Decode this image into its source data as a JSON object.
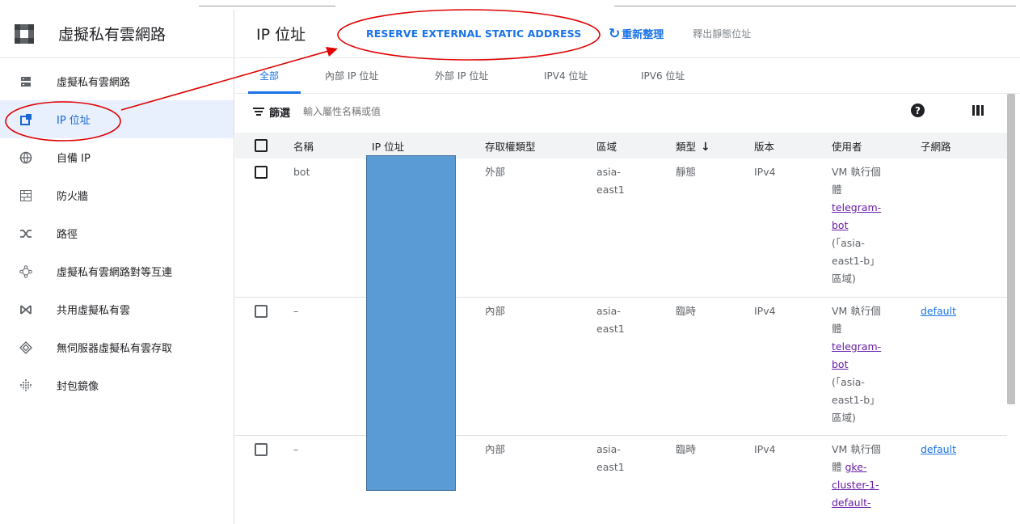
{
  "sidebar": {
    "title": "虛擬私有雲網路",
    "items": [
      {
        "label": "虛擬私有雲網路",
        "icon": "vpc-network-icon"
      },
      {
        "label": "IP 位址",
        "icon": "ip-address-icon"
      },
      {
        "label": "自備 IP",
        "icon": "byoip-globe-icon"
      },
      {
        "label": "防火牆",
        "icon": "firewall-icon"
      },
      {
        "label": "路徑",
        "icon": "routes-icon"
      },
      {
        "label": "虛擬私有雲網路對等互連",
        "icon": "peering-icon"
      },
      {
        "label": "共用虛擬私有雲",
        "icon": "shared-vpc-icon"
      },
      {
        "label": "無伺服器虛擬私有雲存取",
        "icon": "serverless-access-icon"
      },
      {
        "label": "封包鏡像",
        "icon": "packet-mirroring-icon"
      }
    ]
  },
  "toolbar": {
    "title": "IP 位址",
    "reserve_label": "RESERVE EXTERNAL STATIC ADDRESS",
    "refresh_label": "重新整理",
    "release_label": "釋出靜態位址"
  },
  "tabs": [
    "全部",
    "內部 IP 位址",
    "外部 IP 位址",
    "IPV4 位址",
    "IPV6 位址"
  ],
  "filter": {
    "label": "篩選",
    "placeholder": "輸入屬性名稱或值"
  },
  "table": {
    "headers": [
      "名稱",
      "IP 位址",
      "存取權類型",
      "區域",
      "類型",
      "版本",
      "使用者",
      "子網路"
    ],
    "rows": [
      {
        "name": "bot",
        "ip": "",
        "access": "外部",
        "region_a": "asia-",
        "region_b": "east1",
        "type": "靜態",
        "version": "IPv4",
        "user_a": "VM 執行個",
        "user_b": "體",
        "link_a": "telegram-",
        "link_b": "bot",
        "zone_a": "(「asia-",
        "zone_b": "east1-b」",
        "zone_c": "區域)",
        "subnet": ""
      },
      {
        "name": "–",
        "ip": "",
        "access": "內部",
        "region_a": "asia-",
        "region_b": "east1",
        "type": "臨時",
        "version": "IPv4",
        "user_a": "VM 執行個",
        "user_b": "體",
        "link_a": "telegram-",
        "link_b": "bot",
        "zone_a": "(「asia-",
        "zone_b": "east1-b」",
        "zone_c": "區域)",
        "subnet": "default"
      },
      {
        "name": "–",
        "ip": "",
        "access": "內部",
        "region_a": "asia-",
        "region_b": "east1",
        "type": "臨時",
        "version": "IPv4",
        "user_a": "VM 執行個",
        "user_b": "體",
        "link_a": "gke-",
        "link_b": "cluster-1-",
        "link_c": "default-",
        "subnet": "default"
      }
    ]
  },
  "colors": {
    "accent": "#1a73e8",
    "annotation": "#e00000",
    "redaction": "#5b9bd5"
  }
}
